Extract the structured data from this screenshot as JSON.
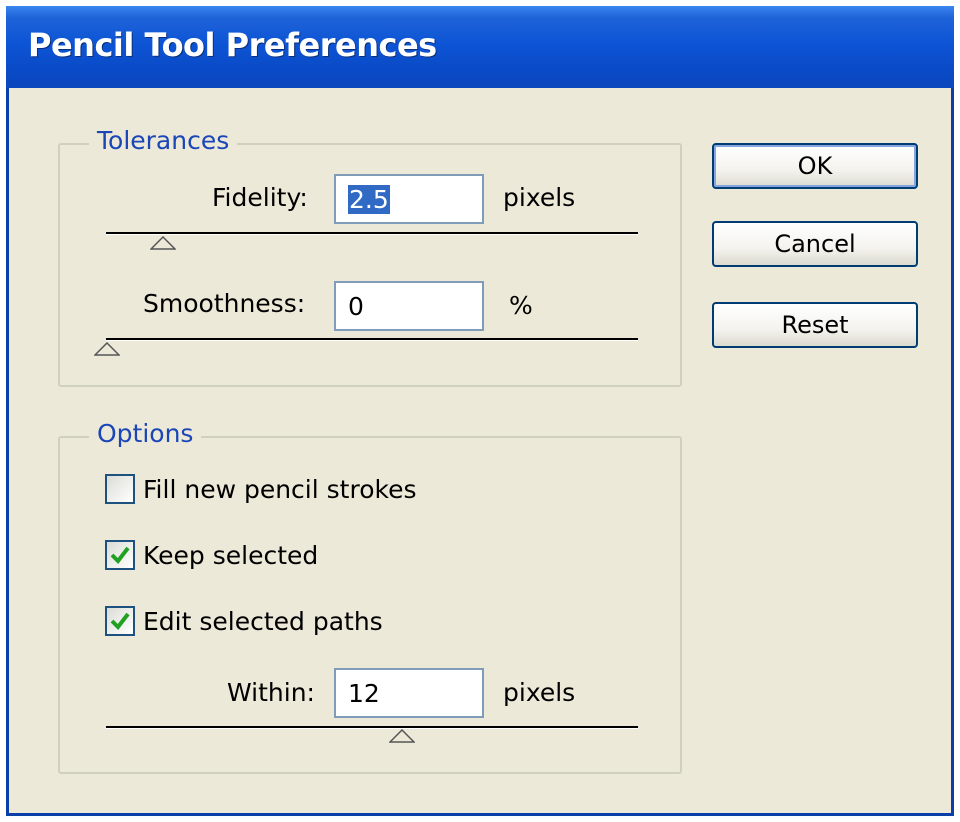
{
  "window": {
    "title": "Pencil Tool Preferences"
  },
  "tolerances": {
    "legend": "Tolerances",
    "fidelity": {
      "label": "Fidelity:",
      "value": "2.5",
      "unit": "pixels"
    },
    "smoothness": {
      "label": "Smoothness:",
      "value": "0",
      "unit": "%"
    }
  },
  "options": {
    "legend": "Options",
    "fill_new": {
      "label": "Fill new pencil strokes",
      "checked": false
    },
    "keep_selected": {
      "label": "Keep selected",
      "checked": true
    },
    "edit_selected": {
      "label": "Edit selected paths",
      "checked": true
    },
    "within": {
      "label": "Within:",
      "value": "12",
      "unit": "pixels"
    }
  },
  "buttons": {
    "ok": "OK",
    "cancel": "Cancel",
    "reset": "Reset"
  },
  "colors": {
    "title_bar": "#0a4bc8",
    "dialog_bg": "#ece9d8",
    "legend_text": "#1a46b8",
    "selection": "#316ac5",
    "check_mark": "#21a121"
  }
}
